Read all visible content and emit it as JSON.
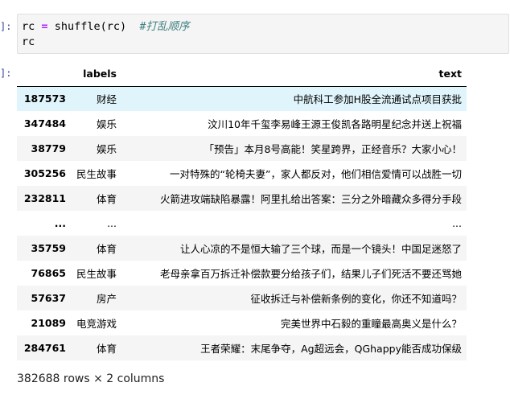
{
  "prompts": {
    "input": "]:",
    "output": "]:"
  },
  "code": {
    "line1_var": "rc",
    "line1_op": "=",
    "line1_call": "shuffle(rc)",
    "line1_comment": "#打乱顺序",
    "line2": "rc"
  },
  "table": {
    "header": {
      "index": "",
      "labels": "labels",
      "text": "text"
    },
    "rows": [
      {
        "index": "187573",
        "labels": "财经",
        "text": "中航科工参加H股全流通试点项目获批"
      },
      {
        "index": "347484",
        "labels": "娱乐",
        "text": "汶川10年千玺李易峰王源王俊凯各路明星纪念并送上祝福"
      },
      {
        "index": "38779",
        "labels": "娱乐",
        "text": "「预告」本月8号高能！笑星跨界，正经音乐？大家小心！"
      },
      {
        "index": "305256",
        "labels": "民生故事",
        "text": "一对特殊的“轮椅夫妻”，家人都反对，他们相信爱情可以战胜一切"
      },
      {
        "index": "232811",
        "labels": "体育",
        "text": "火箭进攻端缺陷暴露！阿里扎给出答案：三分之外暗藏众多得分手段"
      },
      {
        "index": "...",
        "labels": "...",
        "text": "..."
      },
      {
        "index": "35759",
        "labels": "体育",
        "text": "让人心凉的不是恒大输了三个球，而是一个镜头！中国足迷怒了"
      },
      {
        "index": "76865",
        "labels": "民生故事",
        "text": "老母亲拿百万拆迁补偿款要分给孩子们，结果儿子们死活不要还骂她"
      },
      {
        "index": "57637",
        "labels": "房产",
        "text": "征收拆迁与补偿新条例的变化，你还不知道吗？"
      },
      {
        "index": "21089",
        "labels": "电竞游戏",
        "text": "完美世界中石毅的重瞳最高奥义是什么？"
      },
      {
        "index": "284761",
        "labels": "体育",
        "text": "王者荣耀：末尾争夺，Ag超远会，QGhappy能否成功保级"
      }
    ]
  },
  "footer": "382688 rows × 2 columns"
}
